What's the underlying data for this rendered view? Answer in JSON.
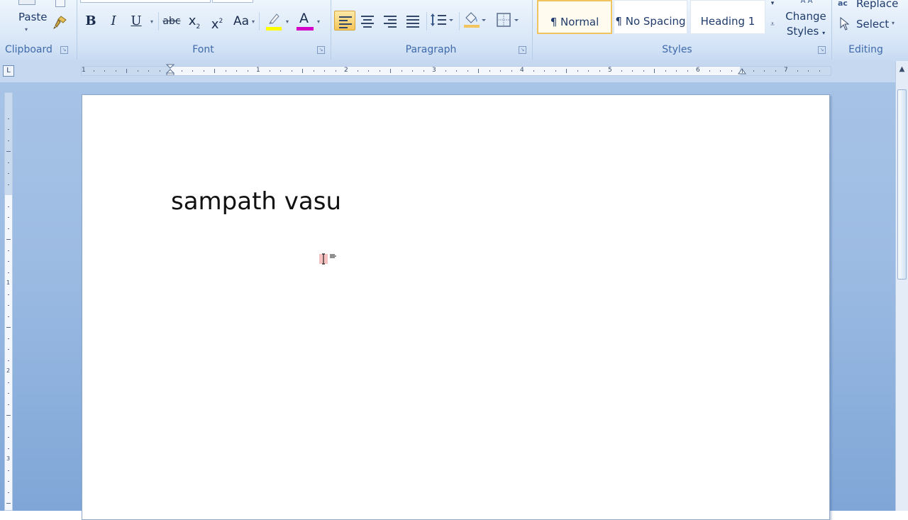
{
  "ribbon": {
    "clipboard": {
      "label": "Clipboard",
      "paste_label": "Paste"
    },
    "font": {
      "label": "Font",
      "bold": "B",
      "italic": "I",
      "underline": "U",
      "strike": "abc",
      "subscript": "x",
      "superscript": "x",
      "case": "Aa",
      "font_color_letter": "A",
      "highlight_color": "#ffff00",
      "font_color": "#d400c8"
    },
    "paragraph": {
      "label": "Paragraph"
    },
    "styles": {
      "label": "Styles",
      "items": [
        {
          "label": "¶ Normal",
          "active": true
        },
        {
          "label": "¶ No Spacing",
          "active": false
        },
        {
          "label": "Heading 1",
          "active": false
        }
      ],
      "change_styles_line1": "Change",
      "change_styles_line2": "Styles"
    },
    "editing": {
      "label": "Editing",
      "replace_label": "Replace",
      "select_label": "Select"
    }
  },
  "ruler": {
    "corner_glyph": "L",
    "h_numbers": [
      "1",
      "1",
      "2",
      "3",
      "4",
      "5",
      "6",
      "7"
    ],
    "v_numbers": [
      "1",
      "2",
      "3"
    ]
  },
  "document": {
    "text": "sampath vasu"
  },
  "colors": {
    "accent_blue": "#3e6aaa",
    "workspace_blue": "#9dbce3",
    "active_style_border": "#f2c45f"
  }
}
